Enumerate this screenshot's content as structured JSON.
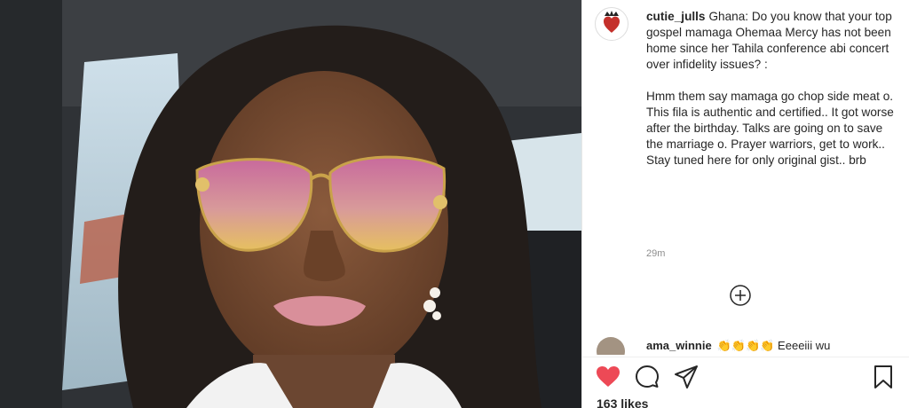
{
  "post": {
    "username": "cutie_julls",
    "caption_lines_1": "Ghana: Do you know that your top gospel mamaga Ohemaa Mercy has not been home since her Tahila conference abi concert over infidelity issues? :",
    "caption_lines_2": "Hmm them say mamaga go chop side meat o. This fila is authentic and certified.. It got worse after the birthday. Talks are going on to save the marriage o. Prayer warriors, get to work.. Stay tuned here for only original gist.. brb",
    "time": "29m"
  },
  "comment": {
    "username": "ama_winnie",
    "text": "👏👏👏👏 Eeeeiii wu"
  },
  "likes": "163 likes",
  "colors": {
    "heart": "#ed4956",
    "text": "#262626",
    "muted": "#8e8e8e"
  },
  "icons": [
    "heart-icon",
    "comment-icon",
    "share-icon",
    "bookmark-icon",
    "add-circle-icon"
  ]
}
